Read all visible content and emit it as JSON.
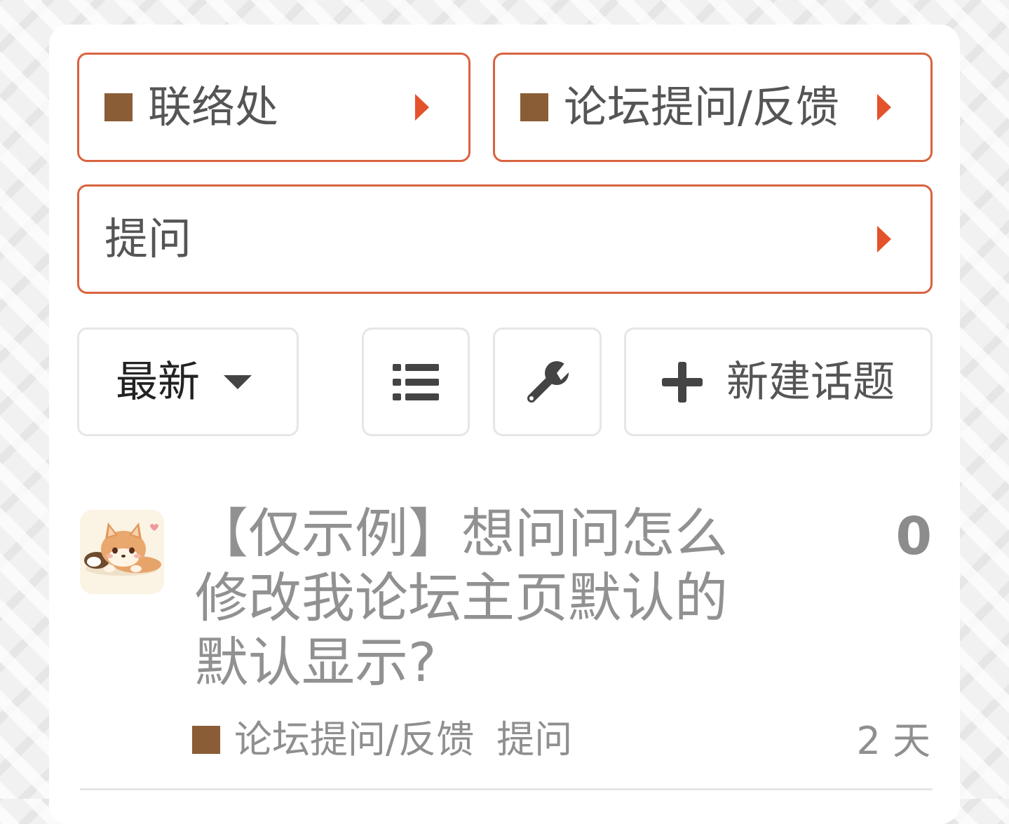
{
  "breadcrumbs": {
    "category": {
      "label": "联络处",
      "color": "#8a5d36"
    },
    "subcategory": {
      "label": "论坛提问/反馈",
      "color": "#8a5d36"
    },
    "tag": {
      "label": "提问"
    }
  },
  "toolbar": {
    "sort_label": "最新",
    "new_topic_label": "新建话题",
    "icons": [
      "chevron-down-icon",
      "list-icon",
      "wrench-icon",
      "plus-icon"
    ]
  },
  "topics": [
    {
      "title": "【仅示例】想问问怎么修改我论坛主页默认的默认显示?",
      "replies": "0",
      "category": "论坛提问/反馈",
      "category_color": "#8a5d36",
      "tag": "提问",
      "age": "2 天"
    }
  ],
  "colors": {
    "accent": "#d9633f",
    "caret": "#e3522a",
    "category_swatch": "#8a5d36"
  }
}
